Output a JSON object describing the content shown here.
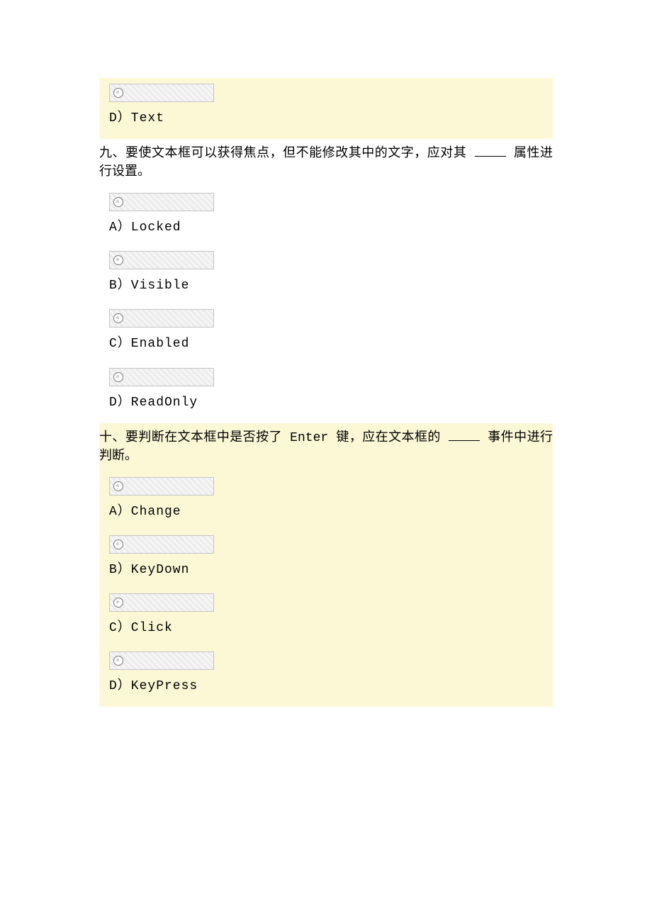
{
  "q8_tail": {
    "label": "D）Text"
  },
  "q9": {
    "text_a": "九、要使文本框可以获得焦点，但不能修改其中的文字，应对其 ",
    "text_c": " 属性进行设置。",
    "opts": {
      "a": "A）Locked",
      "b": "B）Visible",
      "c": "C）Enabled",
      "d": "D）ReadOnly"
    }
  },
  "q10": {
    "text_a": "十、要判断在文本框中是否按了 Enter 键，应在文本框的 ",
    "text_c": " 事件中进行判断。",
    "opts": {
      "a": "A）Change",
      "b": "B）KeyDown",
      "c": "C）Click",
      "d": "D）KeyPress"
    }
  }
}
